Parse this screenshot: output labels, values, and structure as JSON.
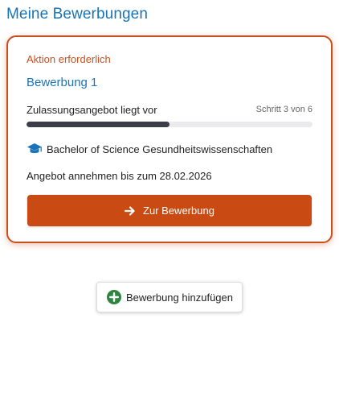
{
  "header": {
    "title": "Meine Bewerbungen"
  },
  "application_card": {
    "action_label": "Aktion erforderlich",
    "name": "Bewerbung 1",
    "status": "Zulassungsangebot liegt vor",
    "step_label": "Schritt 3 von 6",
    "progress_fraction": 0.5,
    "degree_icon": "graduation-cap-icon",
    "degree": "Bachelor of Science Gesundheitswissenschaften",
    "deadline_prefix": "Angebot annehmen",
    "deadline_suffix": "bis zum 28.02.2026",
    "button_label": "Zur Bewerbung",
    "button_icon": "arrow-right-icon"
  },
  "add_application": {
    "label": "Bewerbung hinzufügen",
    "icon": "plus-circle-icon"
  },
  "colors": {
    "title_blue": "#1a73b8",
    "accent_orange": "#c94a12",
    "progress_dark": "#3c3c4a",
    "add_icon_green": "#2e8540"
  }
}
